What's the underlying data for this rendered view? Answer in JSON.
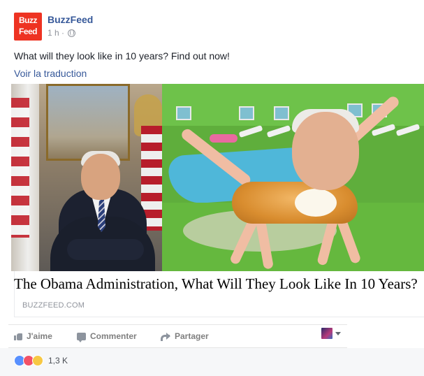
{
  "post": {
    "page_name": "BuzzFeed",
    "logo_line1": "Buzz",
    "logo_line2": "Feed",
    "time": "1 h ·",
    "text": "What will they look like in 10 years? Find out now!",
    "translate": "Voir la traduction"
  },
  "link": {
    "headline": "The Obama Administration, What Will They Look Like In 10 Years?",
    "domain": "BUZZFEED.COM"
  },
  "actions": {
    "like": "J'aime",
    "comment": "Commenter",
    "share": "Partager"
  },
  "reactions": {
    "count": "1,3 K",
    "like_glyph": "👍",
    "love_glyph": "♥",
    "haha_glyph": "😆"
  },
  "colors": {
    "link": "#365899",
    "brand": "#ee3322",
    "muted": "#90949c"
  },
  "icons": [
    "globe-icon",
    "like-icon",
    "comment-icon",
    "share-icon",
    "chevron-down-icon"
  ]
}
